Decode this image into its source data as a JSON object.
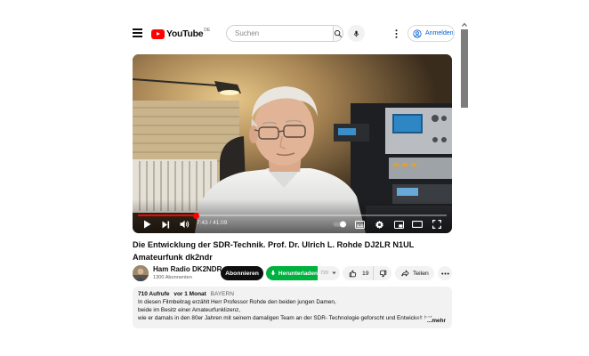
{
  "header": {
    "logo_text": "YouTube",
    "logo_country": "DE",
    "search_placeholder": "Suchen",
    "signin_label": "Anmelden",
    "icons": [
      "menu-icon",
      "youtube-logo-icon",
      "search-icon",
      "microphone-icon",
      "more-vertical-icon",
      "account-circle-icon"
    ]
  },
  "player": {
    "time_current": "7:43",
    "time_separator": " / ",
    "time_total": "41:09",
    "progress_fraction": 0.188,
    "controls": [
      "play-icon",
      "next-icon",
      "volume-icon",
      "autoplay-toggle",
      "subtitles-icon",
      "settings-icon",
      "miniplayer-icon",
      "theater-icon",
      "fullscreen-icon"
    ]
  },
  "video": {
    "title": "Die Entwicklung der SDR-Technik. Prof. Dr. Ulrich L. Rohde DJ2LR N1UL Amateurfunk dk2ndr"
  },
  "channel": {
    "name": "Ham Radio DK2NDR",
    "subscribers": "1300 Abonnenten",
    "subscribe_label": "Abonnieren"
  },
  "actions": {
    "download_label": "Herunterladen",
    "download_quality": "720",
    "like_count": "19",
    "share_label": "Teilen"
  },
  "description": {
    "views": "710 Aufrufe",
    "age": "vor 1 Monat",
    "location": "BAYERN",
    "lines": [
      "In diesen Filmbeitrag erzählt Herr Professor Rohde den beiden jungen Damen,",
      "beide im Besitz einer Amateurfunklizenz,",
      "wie er damals in den 80er Jahren mit seinem damaligen Team an der SDR- Technologie geforscht und Entwickelt hat"
    ],
    "more_label": "...mehr"
  },
  "colors": {
    "brand_red": "#ff0000",
    "download_green": "#00b140",
    "link_blue": "#065fd4",
    "chip_gray": "#f2f2f2"
  }
}
